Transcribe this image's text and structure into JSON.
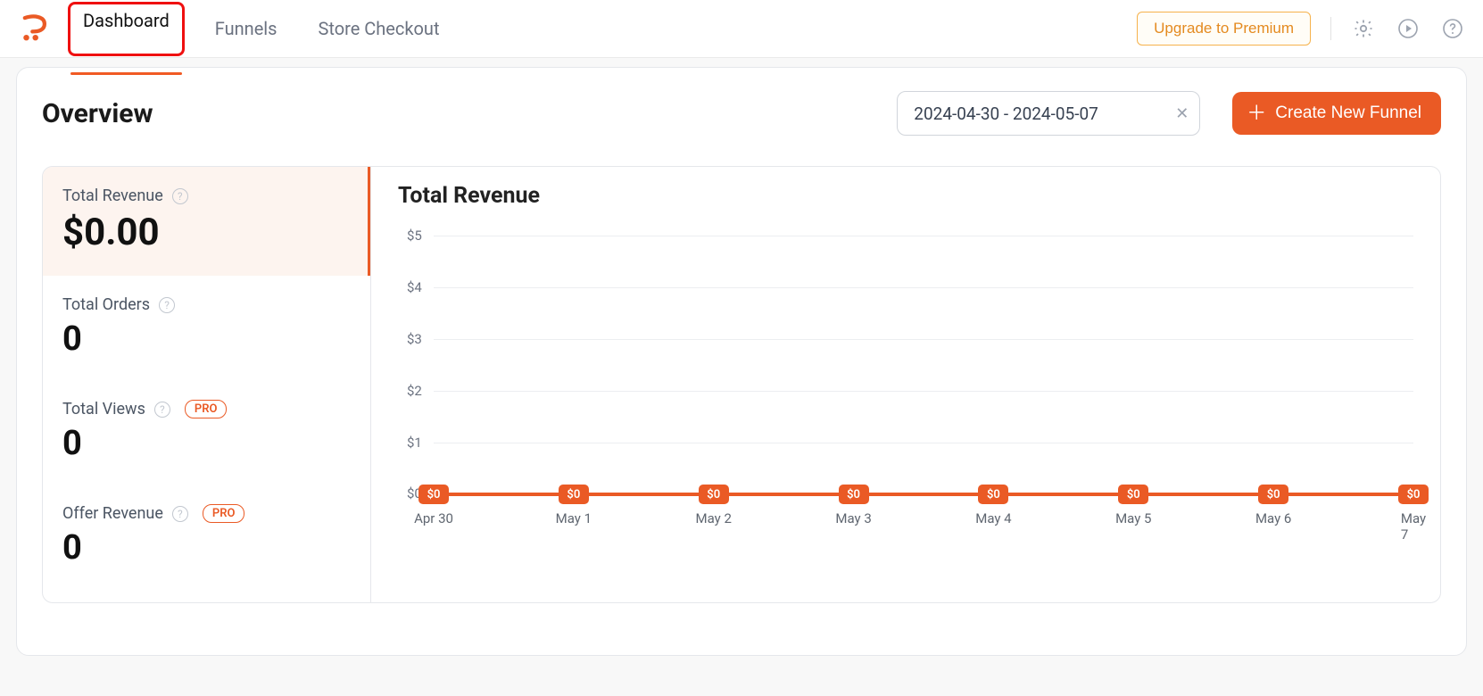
{
  "nav": {
    "dashboard": "Dashboard",
    "funnels": "Funnels",
    "store_checkout": "Store Checkout"
  },
  "topbar": {
    "upgrade": "Upgrade to Premium"
  },
  "page": {
    "title": "Overview",
    "date_range": "2024-04-30 - 2024-05-07",
    "create_btn": "Create New Funnel"
  },
  "stats": {
    "total_revenue": {
      "label": "Total Revenue",
      "value": "$0.00"
    },
    "total_orders": {
      "label": "Total Orders",
      "value": "0"
    },
    "total_views": {
      "label": "Total Views",
      "value": "0",
      "pro": "PRO"
    },
    "offer_revenue": {
      "label": "Offer Revenue",
      "value": "0",
      "pro": "PRO"
    }
  },
  "chart_title": "Total Revenue",
  "chart_data": {
    "type": "line",
    "title": "Total Revenue",
    "xlabel": "",
    "ylabel": "",
    "ylim": [
      0,
      5
    ],
    "y_ticks": [
      "$5",
      "$4",
      "$3",
      "$2",
      "$1",
      "$0"
    ],
    "categories": [
      "Apr 30",
      "May 1",
      "May 2",
      "May 3",
      "May 4",
      "May 5",
      "May 6",
      "May 7"
    ],
    "values": [
      0,
      0,
      0,
      0,
      0,
      0,
      0,
      0
    ],
    "point_labels": [
      "$0",
      "$0",
      "$0",
      "$0",
      "$0",
      "$0",
      "$0",
      "$0"
    ]
  }
}
